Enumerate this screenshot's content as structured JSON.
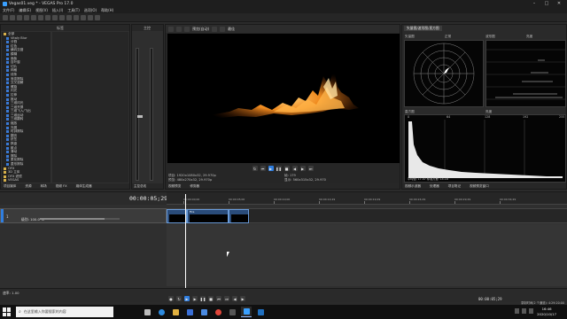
{
  "window": {
    "title": "Vegas01.veg * - VEGAS Pro 17.0"
  },
  "menubar": [
    "文件(F)",
    "编辑(E)",
    "视图(V)",
    "插入(I)",
    "工具(T)",
    "选项(O)",
    "帮助(H)"
  ],
  "explorer": {
    "header": "项目媒体",
    "list_header": "标签",
    "tree": [
      {
        "label": "全部",
        "folder": true
      },
      {
        "label": "Vitaly Blur",
        "folder": false
      },
      {
        "label": "分割",
        "folder": false
      },
      {
        "label": "红色",
        "folder": false
      },
      {
        "label": "横向交错",
        "folder": false
      },
      {
        "label": "模糊",
        "folder": false
      },
      {
        "label": "面板",
        "folder": false
      },
      {
        "label": "百叶窗",
        "folder": false
      },
      {
        "label": "切片",
        "folder": false
      },
      {
        "label": "网格",
        "folder": false
      },
      {
        "label": "线条",
        "folder": false
      },
      {
        "label": "渐变擦除",
        "folder": false
      },
      {
        "label": "交叉溶解",
        "folder": false
      },
      {
        "label": "螺旋",
        "folder": false
      },
      {
        "label": "闪光",
        "folder": false
      },
      {
        "label": "拉伸",
        "folder": false
      },
      {
        "label": "推动",
        "folder": false
      },
      {
        "label": "三维闪光",
        "folder": false
      },
      {
        "label": "三维开屏",
        "folder": false
      },
      {
        "label": "三维飞入/飞出",
        "folder": false
      },
      {
        "label": "三维运动",
        "folder": false
      },
      {
        "label": "三维翻转",
        "folder": false
      },
      {
        "label": "缩放",
        "folder": false
      },
      {
        "label": "光圈",
        "folder": false
      },
      {
        "label": "时钟擦除",
        "folder": false
      },
      {
        "label": "翻页",
        "folder": false
      },
      {
        "label": "挤压",
        "folder": false
      },
      {
        "label": "棋盘",
        "folder": false
      },
      {
        "label": "散点",
        "folder": false
      },
      {
        "label": "滑动",
        "folder": false
      },
      {
        "label": "擦除",
        "folder": false
      },
      {
        "label": "柔化擦除",
        "folder": false
      },
      {
        "label": "菱形擦除",
        "folder": false
      },
      {
        "label": "OFX",
        "folder": true
      },
      {
        "label": "3D 立体",
        "folder": true
      },
      {
        "label": "OFX 滤镜",
        "folder": true
      },
      {
        "label": "VEGAS",
        "folder": true
      },
      {
        "label": "视频FX",
        "folder": true
      }
    ],
    "footer": [
      "项目媒体",
      "资源",
      "转场",
      "视频 FX",
      "媒体生成器"
    ]
  },
  "mixer": {
    "label": "主控",
    "footer": "主控总线"
  },
  "preview": {
    "toolbar_label": "预览(自动)",
    "toolbar_mode": "最佳",
    "info": {
      "project_label": "项目:",
      "project_value": "1920x1080x32, 29.970p",
      "preview_label": "预览:",
      "preview_value": "480x270x32, 29.970p",
      "frame_label": "帧:",
      "frame_value": "179",
      "display_label": "显示:",
      "display_value": "560x315x32, 29.970"
    },
    "footer": [
      "视频预览",
      "修剪器"
    ]
  },
  "scopes": {
    "tab": "矢量图/波形图/直方图",
    "vectorscope_label": "矢量图",
    "vectorscope_mode": "正常",
    "waveform_label": "波形图",
    "waveform_mode": "亮度",
    "histogram_label": "直方图",
    "histogram_mode": "亮度",
    "hist_ticks": [
      "0",
      "64",
      "128",
      "192",
      "255"
    ],
    "hist_stats": "平均值: 17.47   标准方差: 14.18",
    "footer": [
      "视频示波器",
      "处理器",
      "项目笔记",
      "视频预览窗口"
    ]
  },
  "timeline": {
    "timecode": "00:00:05;29",
    "ruler": [
      "00:00:00;00",
      "00:00:05;00",
      "00:00:10;00",
      "00:00:14;29",
      "00:00:19;29",
      "00:00:24;29",
      "00:00:29;29",
      "00:00:34;29"
    ],
    "track_number": "1",
    "level_label": "级别: 100.0 %",
    "level_percent": 100,
    "clip_label": "Fire",
    "rate": "速率: 1.00",
    "end_time": "00:00:05;29",
    "status": "录制时间(2 个通道): 4:29:20:00"
  },
  "taskbar": {
    "search_placeholder": "在这里输入你要搜索的内容",
    "time": "16:46",
    "date": "2020/10/17"
  }
}
